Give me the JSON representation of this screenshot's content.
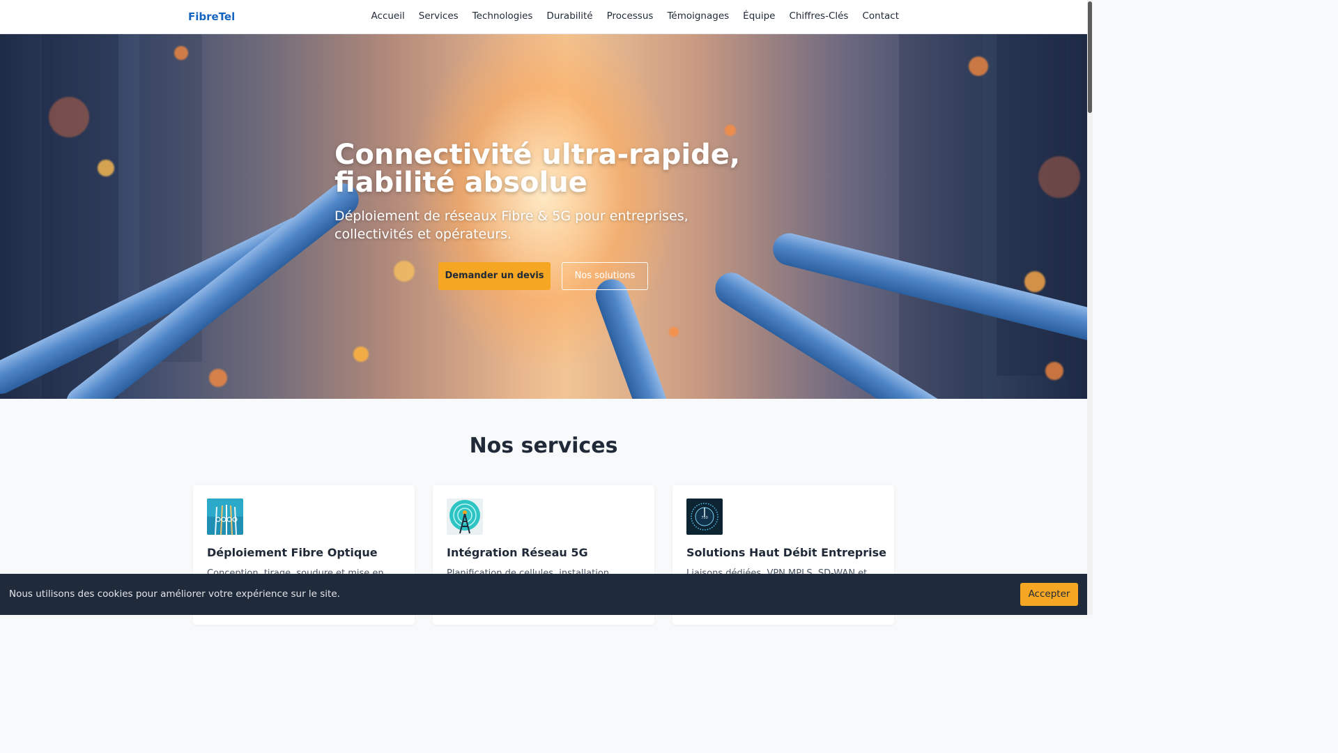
{
  "header": {
    "brand": "FibreTel",
    "nav": [
      "Accueil",
      "Services",
      "Technologies",
      "Durabilité",
      "Processus",
      "Témoignages",
      "Équipe",
      "Chiffres-Clés",
      "Contact"
    ]
  },
  "hero": {
    "title_line1": "Connectivité ultra-rapide,",
    "title_line2": "fiabilité absolue",
    "subtitle_line1": "Déploiement de réseaux Fibre & 5G pour entreprises,",
    "subtitle_line2": "collectivités et opérateurs.",
    "primary_button": "Demander un devis",
    "secondary_button": "Nos solutions",
    "background_image": "fiber-optic-cables-city-sunset"
  },
  "services": {
    "title": "Nos services",
    "cards": [
      {
        "icon": "fiber-optic-image",
        "title": "Déploiement Fibre Optique",
        "description": "Conception, tirage, soudure et mise en"
      },
      {
        "icon": "5g-tower-image",
        "title": "Intégration Réseau 5G",
        "description": "Planification de cellules, installation"
      },
      {
        "icon": "speedometer-image",
        "title": "Solutions Haut Débit Entreprise",
        "description": "Liaisons dédiées, VPN MPLS, SD-WAN et"
      }
    ]
  },
  "cookie": {
    "text": "Nous utilisons des cookies pour améliorer votre expérience sur le site.",
    "button": "Accepter"
  },
  "colors": {
    "brand": "#1565c0",
    "accent": "#f5a623",
    "cookie_bg": "#1f2a3a"
  }
}
